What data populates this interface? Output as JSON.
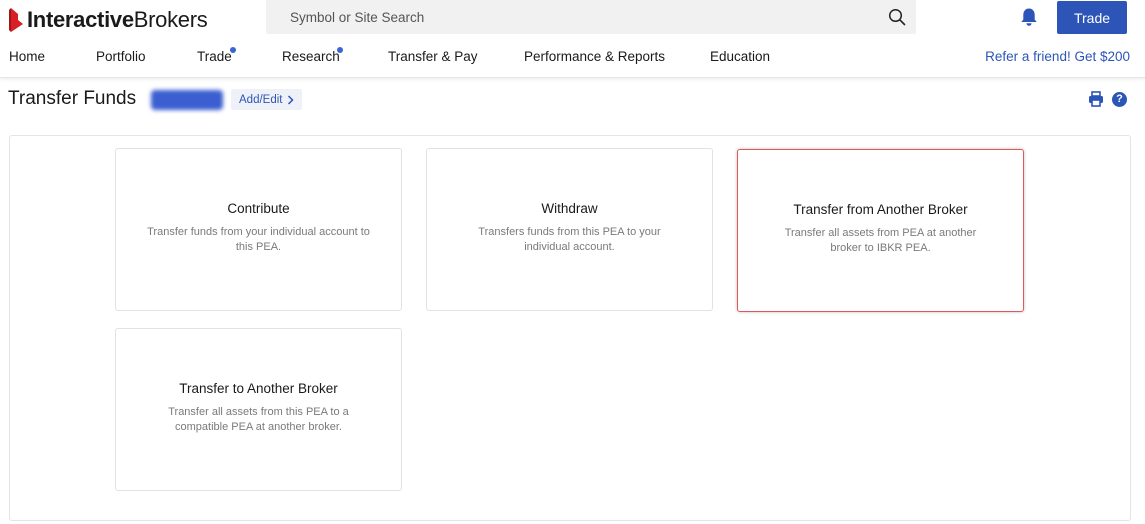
{
  "header": {
    "logo": {
      "part1": "Interactive",
      "part2": "Brokers"
    },
    "search": {
      "placeholder": "Symbol or Site Search"
    },
    "trade_label": "Trade",
    "accent_color": "#2d55b7",
    "logo_color": "#d81f26"
  },
  "nav": {
    "items": [
      {
        "label": "Home",
        "dot": false
      },
      {
        "label": "Portfolio",
        "dot": false
      },
      {
        "label": "Trade",
        "dot": true
      },
      {
        "label": "Research",
        "dot": true
      },
      {
        "label": "Transfer & Pay",
        "dot": false
      },
      {
        "label": "Performance & Reports",
        "dot": false
      },
      {
        "label": "Education",
        "dot": false
      }
    ],
    "refer": "Refer a friend! Get $200"
  },
  "page": {
    "title": "Transfer Funds",
    "add_edit": "Add/Edit"
  },
  "cards": [
    {
      "title": "Contribute",
      "desc": "Transfer funds from your individual account to this PEA.",
      "highlighted": false
    },
    {
      "title": "Withdraw",
      "desc": "Transfers funds from this PEA to your individual account.",
      "highlighted": false
    },
    {
      "title": "Transfer from Another Broker",
      "desc": "Transfer all assets from PEA at another broker to IBKR PEA.",
      "highlighted": true
    },
    {
      "title": "Transfer to Another Broker",
      "desc": "Transfer all assets from this PEA to a compatible PEA at another broker.",
      "highlighted": false
    }
  ],
  "icons": {
    "logo": "ib-logo-icon",
    "search": "search-icon",
    "bell": "bell-icon",
    "print": "print-icon",
    "help": "help-icon",
    "chevron": "chevron-right-icon"
  }
}
